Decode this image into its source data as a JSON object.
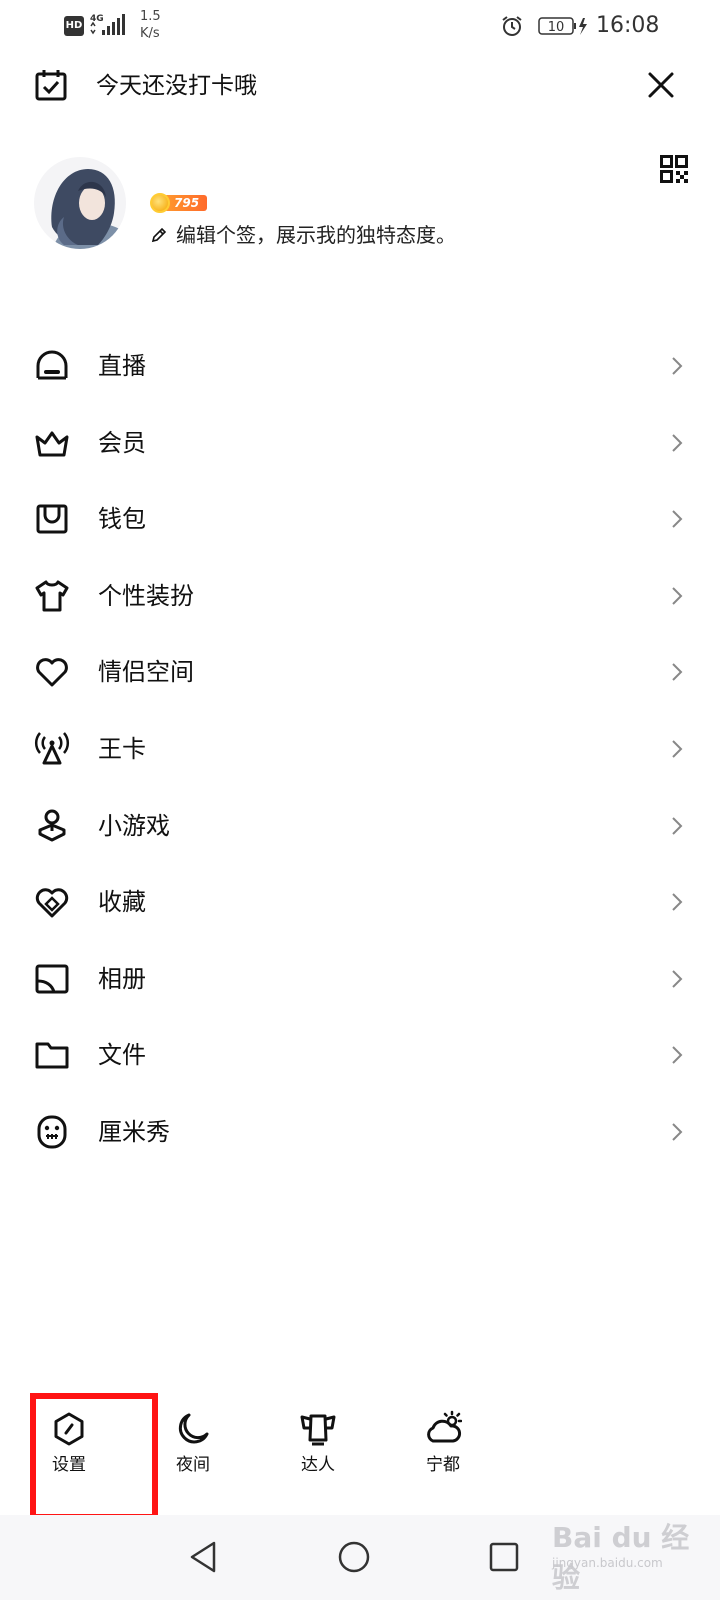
{
  "status_bar": {
    "hd": "HD",
    "network": "4G",
    "speed_value": "1.5",
    "speed_unit": "K/s",
    "battery": "10",
    "time": "16:08"
  },
  "header": {
    "checkin_text": "今天还没打卡哦",
    "close_icon": "close-icon",
    "qr_icon": "qr-code-icon"
  },
  "profile": {
    "level": "795",
    "signature": "编辑个签，展示我的独特态度。"
  },
  "menu": {
    "items": [
      {
        "label": "直播",
        "icon": "live-icon"
      },
      {
        "label": "会员",
        "icon": "crown-icon"
      },
      {
        "label": "钱包",
        "icon": "wallet-icon"
      },
      {
        "label": "个性装扮",
        "icon": "tshirt-icon"
      },
      {
        "label": "情侣空间",
        "icon": "heart-icon"
      },
      {
        "label": "王卡",
        "icon": "antenna-icon"
      },
      {
        "label": "小游戏",
        "icon": "joystick-icon"
      },
      {
        "label": "收藏",
        "icon": "favorite-icon"
      },
      {
        "label": "相册",
        "icon": "album-icon"
      },
      {
        "label": "文件",
        "icon": "folder-icon"
      },
      {
        "label": "厘米秀",
        "icon": "cmshow-icon"
      }
    ]
  },
  "bottom_tools": [
    {
      "label": "设置",
      "icon": "settings-icon"
    },
    {
      "label": "夜间",
      "icon": "moon-icon"
    },
    {
      "label": "达人",
      "icon": "expert-icon"
    },
    {
      "label": "宁都",
      "icon": "weather-icon"
    }
  ],
  "watermark": {
    "text": "Bai du 经验",
    "sub": "jingyan.baidu.com"
  },
  "colors": {
    "highlight": "#ff1414",
    "badge": "#ff6a2b"
  }
}
